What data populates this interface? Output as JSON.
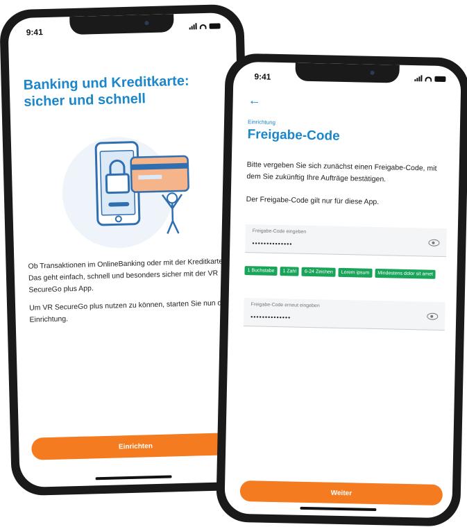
{
  "left_screen": {
    "status_time": "9:41",
    "title": "Banking und Kreditkarte: sicher und schnell",
    "paragraph1": "Ob Transaktionen im OnlineBanking oder mit der Kreditkarte: Das geht einfach, schnell und besonders sicher mit der VR SecureGo plus App.",
    "paragraph2": "Um VR SecureGo plus nutzen zu können, starten Sie nun die Einrichtung.",
    "button_label": "Einrichten"
  },
  "right_screen": {
    "status_time": "9:41",
    "eyebrow": "Einrichtung",
    "title": "Freigabe-Code",
    "paragraph1": "Bitte vergeben Sie sich zunächst einen Freigabe-Code, mit dem Sie zukünftig Ihre Aufträge bestätigen.",
    "paragraph2": "Der Freigabe-Code gilt nur für diese App.",
    "field1": {
      "label": "Freigabe-Code eingeben",
      "value": "••••••••••••••"
    },
    "chips": [
      "1 Buchstabe",
      "1 Zahl",
      "6-24 Zeichen",
      "Lorem ipsum",
      "Mindestens dolor sit amet"
    ],
    "field2": {
      "label": "Freigabe-Code erneut eingeben",
      "value": "••••••••••••••"
    },
    "button_label": "Weiter"
  },
  "colors": {
    "accent_blue": "#1b86c9",
    "cta_orange": "#f47b20",
    "chip_green": "#1aa45a"
  }
}
